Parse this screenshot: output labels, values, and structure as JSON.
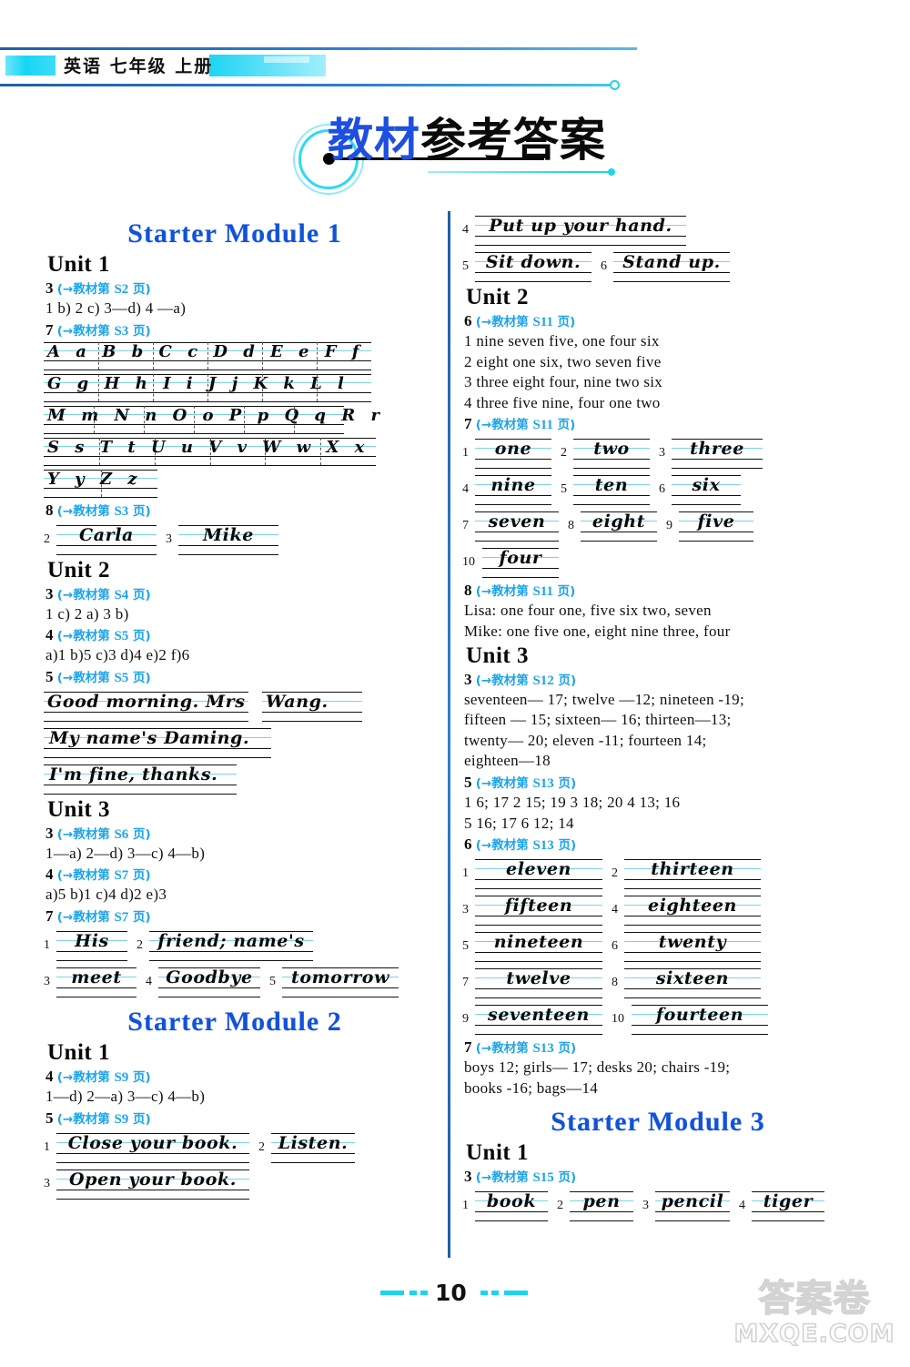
{
  "header": {
    "book_title": "英语 七年级 上册"
  },
  "page_title": {
    "blue_part": "教材",
    "black_part": "参考答案"
  },
  "footer": {
    "page_number": "10",
    "watermark_cn": "答案卷",
    "watermark_en": "MXQE.COM"
  },
  "ref_prefix": "(→教材第 ",
  "ref_suffix": " 页)",
  "left_column": {
    "module_title": "Starter Module 1",
    "units": [
      {
        "unit_label": "Unit 1",
        "blocks": [
          {
            "qn": "3",
            "ref": "S2",
            "answer": "1  b)   2  c)   3—d)   4 —a)"
          },
          {
            "qn": "7",
            "ref": "S3",
            "alphabet_rows": [
              "A a B b C c D d E e F f",
              "G g H h I i J j K k L l",
              "M m N n O o P p Q q R r",
              "S s T t U u V v W w X x",
              "Y y Z z"
            ]
          },
          {
            "qn": "8",
            "ref": "S3",
            "ruled_items": [
              {
                "num": "2",
                "text": "Carla"
              },
              {
                "num": "3",
                "text": "Mike"
              }
            ]
          }
        ]
      },
      {
        "unit_label": "Unit 2",
        "blocks": [
          {
            "qn": "3",
            "ref": "S4",
            "answer": "1  c)   2  a)   3  b)"
          },
          {
            "qn": "4",
            "ref": "S5",
            "answer": "a)1   b)5   c)3   d)4   e)2   f)6"
          },
          {
            "qn": "5",
            "ref": "S5",
            "sentences": [
              "Good morning. Mrs   Wang.",
              "My name's Daming.",
              "I'm fine, thanks."
            ]
          }
        ]
      },
      {
        "unit_label": "Unit 3",
        "blocks": [
          {
            "qn": "3",
            "ref": "S6",
            "answer": "1—a)   2—d)   3—c)   4—b)"
          },
          {
            "qn": "4",
            "ref": "S7",
            "answer": "a)5   b)1   c)4   d)2   e)3"
          },
          {
            "qn": "7",
            "ref": "S7",
            "ruled_items": [
              {
                "num": "1",
                "text": "His"
              },
              {
                "num": "2",
                "text": "friend; name's"
              },
              {
                "num": "3",
                "text": "meet"
              },
              {
                "num": "4",
                "text": "Goodbye"
              },
              {
                "num": "5",
                "text": "tomorrow"
              }
            ]
          }
        ]
      },
      {
        "module_title2": "Starter Module 2",
        "unit_label": "Unit 1",
        "blocks": [
          {
            "qn": "4",
            "ref": "S9",
            "answer": "1—d)   2—a)   3—c)   4—b)"
          },
          {
            "qn": "5",
            "ref": "S9",
            "ruled_items": [
              {
                "num": "1",
                "text": "Close your book."
              },
              {
                "num": "2",
                "text": "Listen."
              },
              {
                "num": "3",
                "text": "Open your book."
              }
            ]
          }
        ]
      }
    ]
  },
  "right_column": {
    "continued_items": [
      {
        "num": "4",
        "text": "Put up your hand."
      },
      {
        "num": "5",
        "text": "Sit down."
      },
      {
        "num": "6",
        "text": "Stand up."
      }
    ],
    "units": [
      {
        "unit_label": "Unit 2",
        "blocks": [
          {
            "qn": "6",
            "ref": "S11",
            "lines": [
              "1 nine seven five, one four six",
              "2 eight one six, two seven five",
              "3 three eight four, nine two six",
              "4 three five nine, four one two"
            ]
          },
          {
            "qn": "7",
            "ref": "S11",
            "ruled_items": [
              {
                "num": "1",
                "text": "one"
              },
              {
                "num": "2",
                "text": "two"
              },
              {
                "num": "3",
                "text": "three"
              },
              {
                "num": "4",
                "text": "nine"
              },
              {
                "num": "5",
                "text": "ten"
              },
              {
                "num": "6",
                "text": "six"
              },
              {
                "num": "7",
                "text": "seven"
              },
              {
                "num": "8",
                "text": "eight"
              },
              {
                "num": "9",
                "text": "five"
              },
              {
                "num": "10",
                "text": "four"
              }
            ]
          },
          {
            "qn": "8",
            "ref": "S11",
            "lines": [
              "Lisa: one four one, five six two, seven",
              "Mike: one five one, eight nine three, four"
            ]
          }
        ]
      },
      {
        "unit_label": "Unit 3",
        "blocks": [
          {
            "qn": "3",
            "ref": "S12",
            "lines": [
              "seventeen— 17; twelve —12; nineteen  -19;",
              "fifteen — 15; sixteen— 16; thirteen—13;",
              "twenty— 20; eleven  -11; fourteen   14;",
              "eighteen—18"
            ]
          },
          {
            "qn": "5",
            "ref": "S13",
            "lines": [
              "1 6; 17   2 15; 19   3 18; 20   4 13; 16",
              "5 16; 17   6 12; 14"
            ]
          },
          {
            "qn": "6",
            "ref": "S13",
            "ruled_items": [
              {
                "num": "1",
                "text": "eleven"
              },
              {
                "num": "2",
                "text": "thirteen"
              },
              {
                "num": "3",
                "text": "fifteen"
              },
              {
                "num": "4",
                "text": "eighteen"
              },
              {
                "num": "5",
                "text": "nineteen"
              },
              {
                "num": "6",
                "text": "twenty"
              },
              {
                "num": "7",
                "text": "twelve"
              },
              {
                "num": "8",
                "text": "sixteen"
              },
              {
                "num": "9",
                "text": "seventeen"
              },
              {
                "num": "10",
                "text": "fourteen"
              }
            ]
          },
          {
            "qn": "7",
            "ref": "S13",
            "lines": [
              "boys  12;    girls— 17;    desks  20;    chairs  -19;",
              "books  -16; bags—14"
            ]
          }
        ]
      },
      {
        "module_title2": "Starter Module 3",
        "unit_label": "Unit 1",
        "blocks": [
          {
            "qn": "3",
            "ref": "S15",
            "ruled_items": [
              {
                "num": "1",
                "text": "book"
              },
              {
                "num": "2",
                "text": "pen"
              },
              {
                "num": "3",
                "text": "pencil"
              },
              {
                "num": "4",
                "text": "tiger"
              }
            ]
          }
        ]
      }
    ]
  }
}
